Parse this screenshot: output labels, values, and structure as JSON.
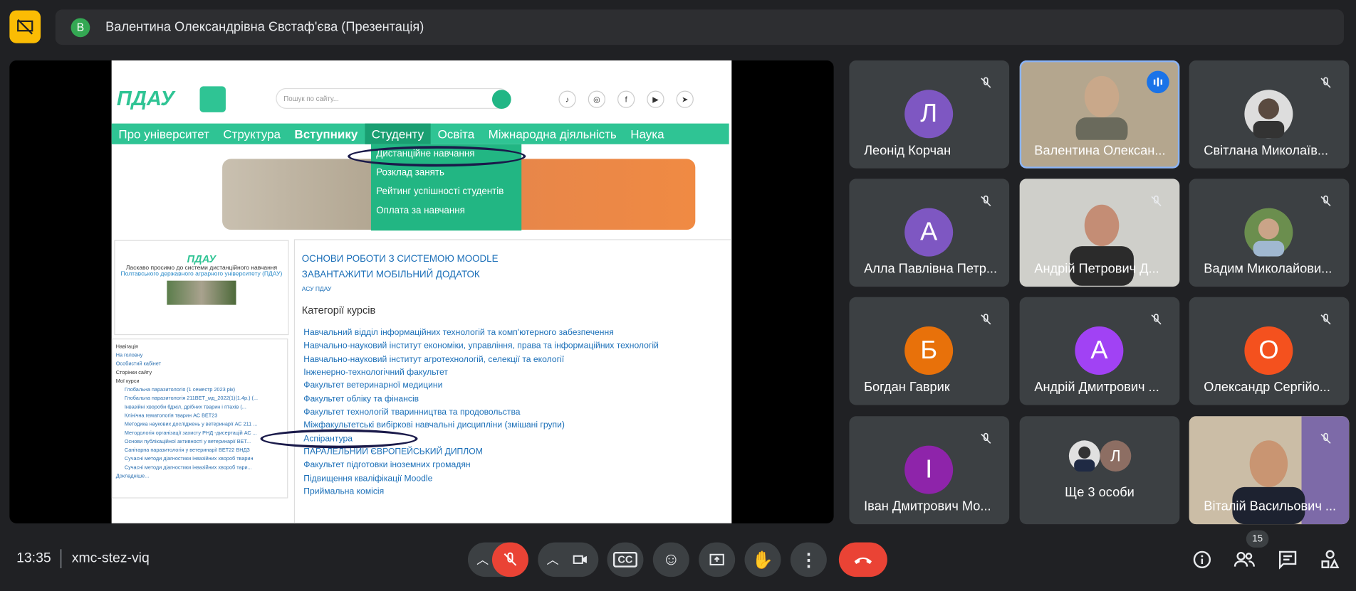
{
  "meeting": {
    "presenter_initial": "В",
    "presenter_label": "Валентина Олександрівна Євстаф'єва (Презентація)",
    "time": "13:35",
    "code": "xmc-stez-viq",
    "participants_count": "15"
  },
  "shared_site": {
    "search_placeholder": "Пошук по сайту...",
    "nav": [
      "Про університет",
      "Структура",
      "Вступнику",
      "Студенту",
      "Освіта",
      "Міжнародна діяльність",
      "Наука"
    ],
    "dropdown": [
      "Дистанційне навчання",
      "Розклад занять",
      "Рейтинг успішності студентів",
      "Оплата за навчання"
    ],
    "welcome": "Ласкаво просимо до системи дистанційного навчання",
    "welcome_sub": "Полтавського державного аграрного університету (ПДАУ)",
    "nav_title": "Навігація",
    "nav_items": [
      "На головну",
      "Особистий кабінет",
      "Сторінки сайту",
      "Мої курси",
      "Глобальна паразитологія (1 семестр 2023 рік)",
      "Глобальна паразитологія 211ВЕТ_мд_2022(1)(1.4р.) (...",
      "Інвазійні хвороби бджіл, дрібних тварин і птахів (...",
      "Клінічна гематологія тварин АС ВЕТ23",
      "Методика наукових досліджень у ветеринарії АС 211 ...",
      "Методологія організації захисту РНД -дисертацій АС ...",
      "Основи публікаційної активності у ветеринарії ВЕТ...",
      "Санітарна паразитологія у ветеринарії ВЕТ22 ВНДЗ",
      "Сучасні методи діагностики інвазійних хвороб тварин",
      "Сучасні методи діагностики інвазійних хвороб тари...",
      "Докладніше..."
    ],
    "main_h1": "ОСНОВИ РОБОТИ З СИСТЕМОЮ MOODLE",
    "main_h2": "ЗАВАНТАЖИТИ МОБІЛЬНИЙ ДОДАТОК",
    "main_small": "АСУ ПДАУ",
    "categories_title": "Категорії курсів",
    "categories": [
      "Навчальний відділ інформаційних технологій та комп'ютерного забезпечення",
      "Навчально-науковий інститут економіки, управління, права та інформаційних технологій",
      "Навчально-науковий інститут агротехнологій, селекції та екології",
      "Інженерно-технологічний факультет",
      "Факультет ветеринарної медицини",
      "Факультет обліку та фінансів",
      "Факультет технологій тваринництва та продовольства",
      "Міжфакультетські вибіркові навчальні дисципліни (змішані групи)",
      "Аспірантура",
      "ПАРАЛЕЛЬНИЙ ЄВРОПЕЙСЬКИЙ ДИПЛОМ",
      "Факультет підготовки іноземних громадян",
      "Підвищення кваліфікації Moodle",
      "Приймальна комісія"
    ]
  },
  "tiles": [
    {
      "name": "Леонід Корчан",
      "initial": "Л",
      "color": "#7e57c2"
    },
    {
      "name": "Валентина Олексан...",
      "initial": "",
      "color": ""
    },
    {
      "name": "Світлана Миколаїв...",
      "initial": "",
      "color": ""
    },
    {
      "name": "Алла Павлівна Петр...",
      "initial": "А",
      "color": "#7e57c2"
    },
    {
      "name": "Андрій Петрович Д...",
      "initial": "",
      "color": ""
    },
    {
      "name": "Вадим Миколайови...",
      "initial": "",
      "color": ""
    },
    {
      "name": "Богдан Гаврик",
      "initial": "Б",
      "color": "#e8710a"
    },
    {
      "name": "Андрій Дмитрович ...",
      "initial": "А",
      "color": "#a142f4"
    },
    {
      "name": "Олександр Сергійо...",
      "initial": "О",
      "color": "#f4511e"
    },
    {
      "name": "Іван Дмитрович Мо...",
      "initial": "І",
      "color": "#8e24aa"
    },
    {
      "name": "Ще 3 особи",
      "initial": "Л",
      "color": "#8d6e63"
    },
    {
      "name": "Віталій Васильович ...",
      "initial": "",
      "color": ""
    }
  ]
}
